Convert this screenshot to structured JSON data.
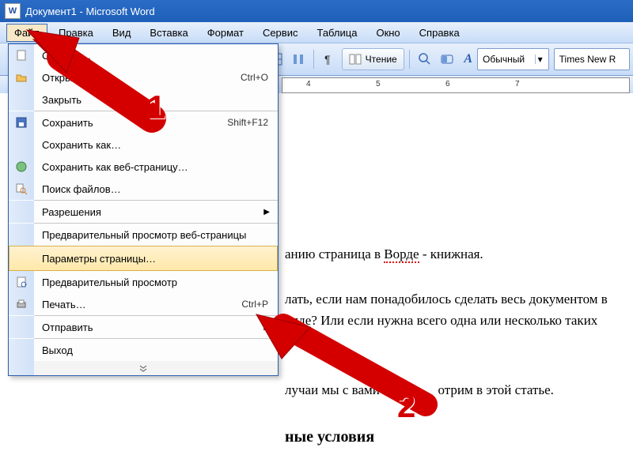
{
  "title": "Документ1 - Microsoft Word",
  "menubar": {
    "file": "Файл",
    "edit": "Правка",
    "view": "Вид",
    "insert": "Вставка",
    "format": "Формат",
    "service": "Сервис",
    "table": "Таблица",
    "window": "Окно",
    "help": "Справка"
  },
  "toolbar": {
    "reading": "Чтение",
    "style_label": "Обычный",
    "font_label": "Times New R"
  },
  "ruler_ticks": [
    "4",
    "5",
    "6",
    "7"
  ],
  "dropdown": {
    "create": "Создать…",
    "open": "Открыть…",
    "open_sc": "Ctrl+O",
    "close": "Закрыть",
    "save": "Сохранить",
    "save_sc": "Shift+F12",
    "save_as": "Сохранить как…",
    "save_web": "Сохранить как веб-страницу…",
    "search_files": "Поиск файлов…",
    "permissions": "Разрешения",
    "preview_web": "Предварительный просмотр веб-страницы",
    "page_setup": "Параметры страницы…",
    "preview": "Предварительный просмотр",
    "print": "Печать…",
    "print_sc": "Ctrl+P",
    "send": "Отправить",
    "exit": "Выход"
  },
  "document": {
    "l1a": "анию страница в ",
    "l1b": "Ворде",
    "l1c": " - книжная.",
    "l2": "лать, если нам понадобилось сделать весь документом в",
    "l3": "виде? Или если нужна всего одна или несколько таких",
    "l4a": "лучаи мы с вами и ра",
    "l4b": "отрим в этой статье.",
    "heading": "ные условия"
  },
  "callouts": {
    "one": "1",
    "two": "2"
  }
}
